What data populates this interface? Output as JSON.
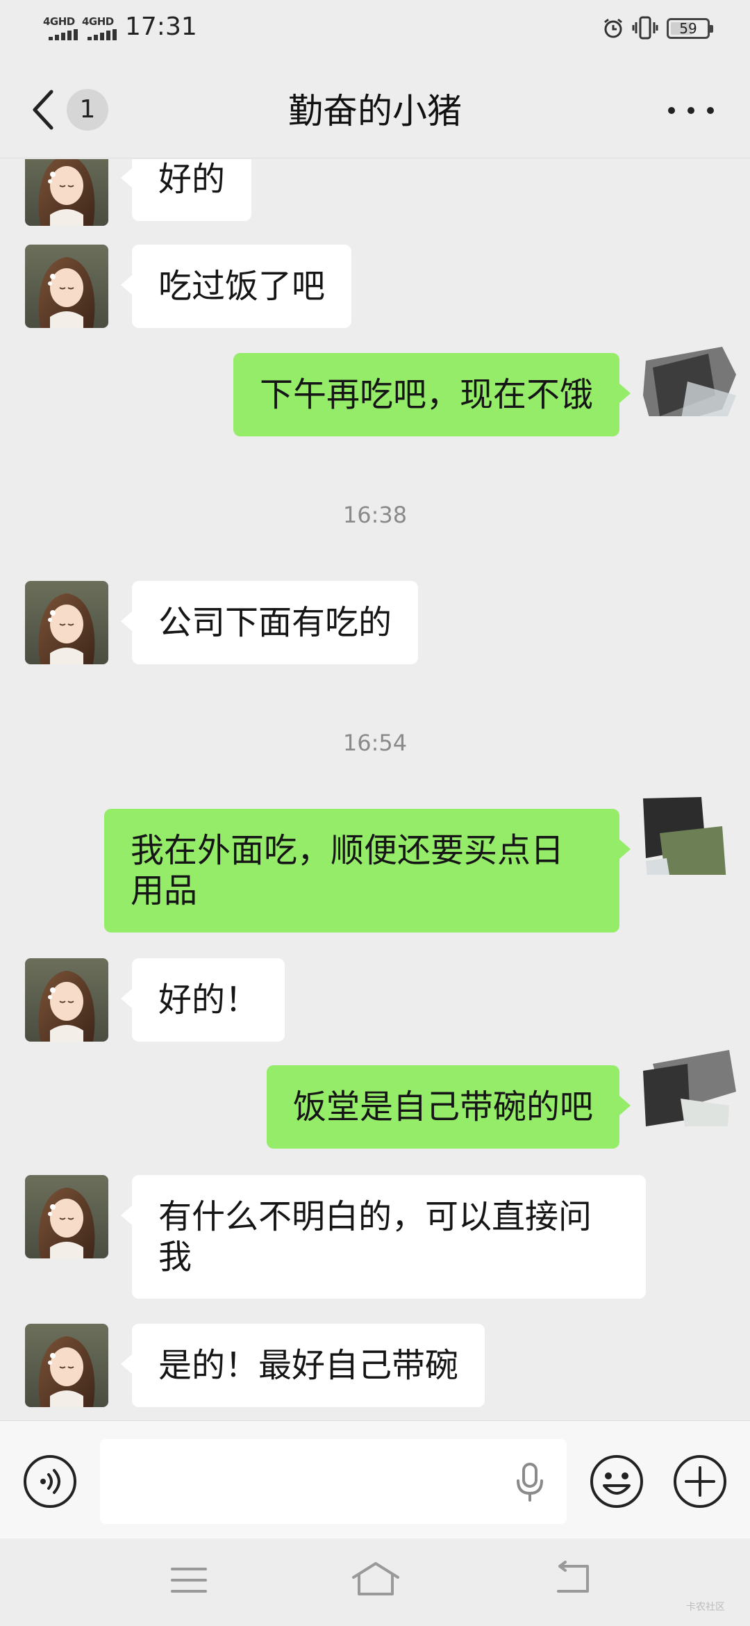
{
  "status_bar": {
    "signal_1": "4GHD",
    "signal_2": "4GHD",
    "time": "17:31",
    "battery_percent": 59,
    "battery_text": "59",
    "icons": [
      "alarm-icon",
      "vibrate-icon",
      "battery-icon"
    ]
  },
  "header": {
    "back_icon": "chevron-left-icon",
    "unread_count": "1",
    "title": "勤奋的小猪",
    "more_icon": "more-dots-icon"
  },
  "messages": [
    {
      "kind": "in",
      "text": "好的"
    },
    {
      "kind": "in",
      "text": "吃过饭了吧"
    },
    {
      "kind": "out",
      "text": "下午再吃吧，现在不饿"
    },
    {
      "kind": "time",
      "text": "16:38"
    },
    {
      "kind": "in",
      "text": "公司下面有吃的"
    },
    {
      "kind": "time",
      "text": "16:54"
    },
    {
      "kind": "out",
      "text": "我在外面吃，顺便还要买点日用品"
    },
    {
      "kind": "in",
      "text": "好的！"
    },
    {
      "kind": "out",
      "text": "饭堂是自己带碗的吧"
    },
    {
      "kind": "in",
      "text": "有什么不明白的，可以直接问我"
    },
    {
      "kind": "in",
      "text": "是的！最好自己带碗"
    }
  ],
  "input_bar": {
    "voice_icon": "voice-icon",
    "input_value": "",
    "mic_icon": "mic-icon",
    "emoji_icon": "emoji-icon",
    "plus_icon": "plus-icon"
  },
  "nav_bar": {
    "icons": [
      "menu-icon",
      "home-icon",
      "back-icon"
    ],
    "watermark": "卡农社区"
  },
  "colors": {
    "background": "#ededed",
    "incoming_bubble": "#ffffff",
    "outgoing_bubble": "#95ec69"
  }
}
